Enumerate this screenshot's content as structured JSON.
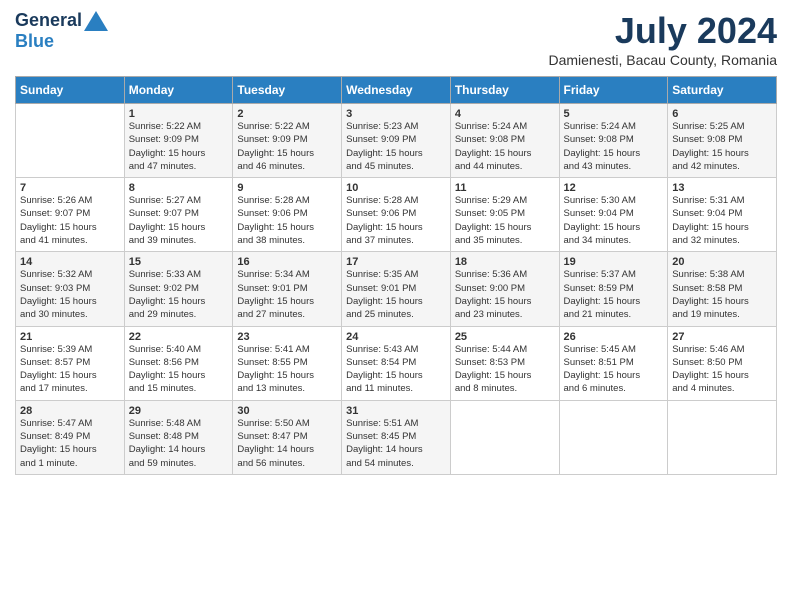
{
  "header": {
    "logo_general": "General",
    "logo_blue": "Blue",
    "month_year": "July 2024",
    "location": "Damienesti, Bacau County, Romania"
  },
  "calendar": {
    "days_of_week": [
      "Sunday",
      "Monday",
      "Tuesday",
      "Wednesday",
      "Thursday",
      "Friday",
      "Saturday"
    ],
    "weeks": [
      [
        {
          "day": "",
          "info": ""
        },
        {
          "day": "1",
          "info": "Sunrise: 5:22 AM\nSunset: 9:09 PM\nDaylight: 15 hours\nand 47 minutes."
        },
        {
          "day": "2",
          "info": "Sunrise: 5:22 AM\nSunset: 9:09 PM\nDaylight: 15 hours\nand 46 minutes."
        },
        {
          "day": "3",
          "info": "Sunrise: 5:23 AM\nSunset: 9:09 PM\nDaylight: 15 hours\nand 45 minutes."
        },
        {
          "day": "4",
          "info": "Sunrise: 5:24 AM\nSunset: 9:08 PM\nDaylight: 15 hours\nand 44 minutes."
        },
        {
          "day": "5",
          "info": "Sunrise: 5:24 AM\nSunset: 9:08 PM\nDaylight: 15 hours\nand 43 minutes."
        },
        {
          "day": "6",
          "info": "Sunrise: 5:25 AM\nSunset: 9:08 PM\nDaylight: 15 hours\nand 42 minutes."
        }
      ],
      [
        {
          "day": "7",
          "info": "Sunrise: 5:26 AM\nSunset: 9:07 PM\nDaylight: 15 hours\nand 41 minutes."
        },
        {
          "day": "8",
          "info": "Sunrise: 5:27 AM\nSunset: 9:07 PM\nDaylight: 15 hours\nand 39 minutes."
        },
        {
          "day": "9",
          "info": "Sunrise: 5:28 AM\nSunset: 9:06 PM\nDaylight: 15 hours\nand 38 minutes."
        },
        {
          "day": "10",
          "info": "Sunrise: 5:28 AM\nSunset: 9:06 PM\nDaylight: 15 hours\nand 37 minutes."
        },
        {
          "day": "11",
          "info": "Sunrise: 5:29 AM\nSunset: 9:05 PM\nDaylight: 15 hours\nand 35 minutes."
        },
        {
          "day": "12",
          "info": "Sunrise: 5:30 AM\nSunset: 9:04 PM\nDaylight: 15 hours\nand 34 minutes."
        },
        {
          "day": "13",
          "info": "Sunrise: 5:31 AM\nSunset: 9:04 PM\nDaylight: 15 hours\nand 32 minutes."
        }
      ],
      [
        {
          "day": "14",
          "info": "Sunrise: 5:32 AM\nSunset: 9:03 PM\nDaylight: 15 hours\nand 30 minutes."
        },
        {
          "day": "15",
          "info": "Sunrise: 5:33 AM\nSunset: 9:02 PM\nDaylight: 15 hours\nand 29 minutes."
        },
        {
          "day": "16",
          "info": "Sunrise: 5:34 AM\nSunset: 9:01 PM\nDaylight: 15 hours\nand 27 minutes."
        },
        {
          "day": "17",
          "info": "Sunrise: 5:35 AM\nSunset: 9:01 PM\nDaylight: 15 hours\nand 25 minutes."
        },
        {
          "day": "18",
          "info": "Sunrise: 5:36 AM\nSunset: 9:00 PM\nDaylight: 15 hours\nand 23 minutes."
        },
        {
          "day": "19",
          "info": "Sunrise: 5:37 AM\nSunset: 8:59 PM\nDaylight: 15 hours\nand 21 minutes."
        },
        {
          "day": "20",
          "info": "Sunrise: 5:38 AM\nSunset: 8:58 PM\nDaylight: 15 hours\nand 19 minutes."
        }
      ],
      [
        {
          "day": "21",
          "info": "Sunrise: 5:39 AM\nSunset: 8:57 PM\nDaylight: 15 hours\nand 17 minutes."
        },
        {
          "day": "22",
          "info": "Sunrise: 5:40 AM\nSunset: 8:56 PM\nDaylight: 15 hours\nand 15 minutes."
        },
        {
          "day": "23",
          "info": "Sunrise: 5:41 AM\nSunset: 8:55 PM\nDaylight: 15 hours\nand 13 minutes."
        },
        {
          "day": "24",
          "info": "Sunrise: 5:43 AM\nSunset: 8:54 PM\nDaylight: 15 hours\nand 11 minutes."
        },
        {
          "day": "25",
          "info": "Sunrise: 5:44 AM\nSunset: 8:53 PM\nDaylight: 15 hours\nand 8 minutes."
        },
        {
          "day": "26",
          "info": "Sunrise: 5:45 AM\nSunset: 8:51 PM\nDaylight: 15 hours\nand 6 minutes."
        },
        {
          "day": "27",
          "info": "Sunrise: 5:46 AM\nSunset: 8:50 PM\nDaylight: 15 hours\nand 4 minutes."
        }
      ],
      [
        {
          "day": "28",
          "info": "Sunrise: 5:47 AM\nSunset: 8:49 PM\nDaylight: 15 hours\nand 1 minute."
        },
        {
          "day": "29",
          "info": "Sunrise: 5:48 AM\nSunset: 8:48 PM\nDaylight: 14 hours\nand 59 minutes."
        },
        {
          "day": "30",
          "info": "Sunrise: 5:50 AM\nSunset: 8:47 PM\nDaylight: 14 hours\nand 56 minutes."
        },
        {
          "day": "31",
          "info": "Sunrise: 5:51 AM\nSunset: 8:45 PM\nDaylight: 14 hours\nand 54 minutes."
        },
        {
          "day": "",
          "info": ""
        },
        {
          "day": "",
          "info": ""
        },
        {
          "day": "",
          "info": ""
        }
      ]
    ]
  }
}
